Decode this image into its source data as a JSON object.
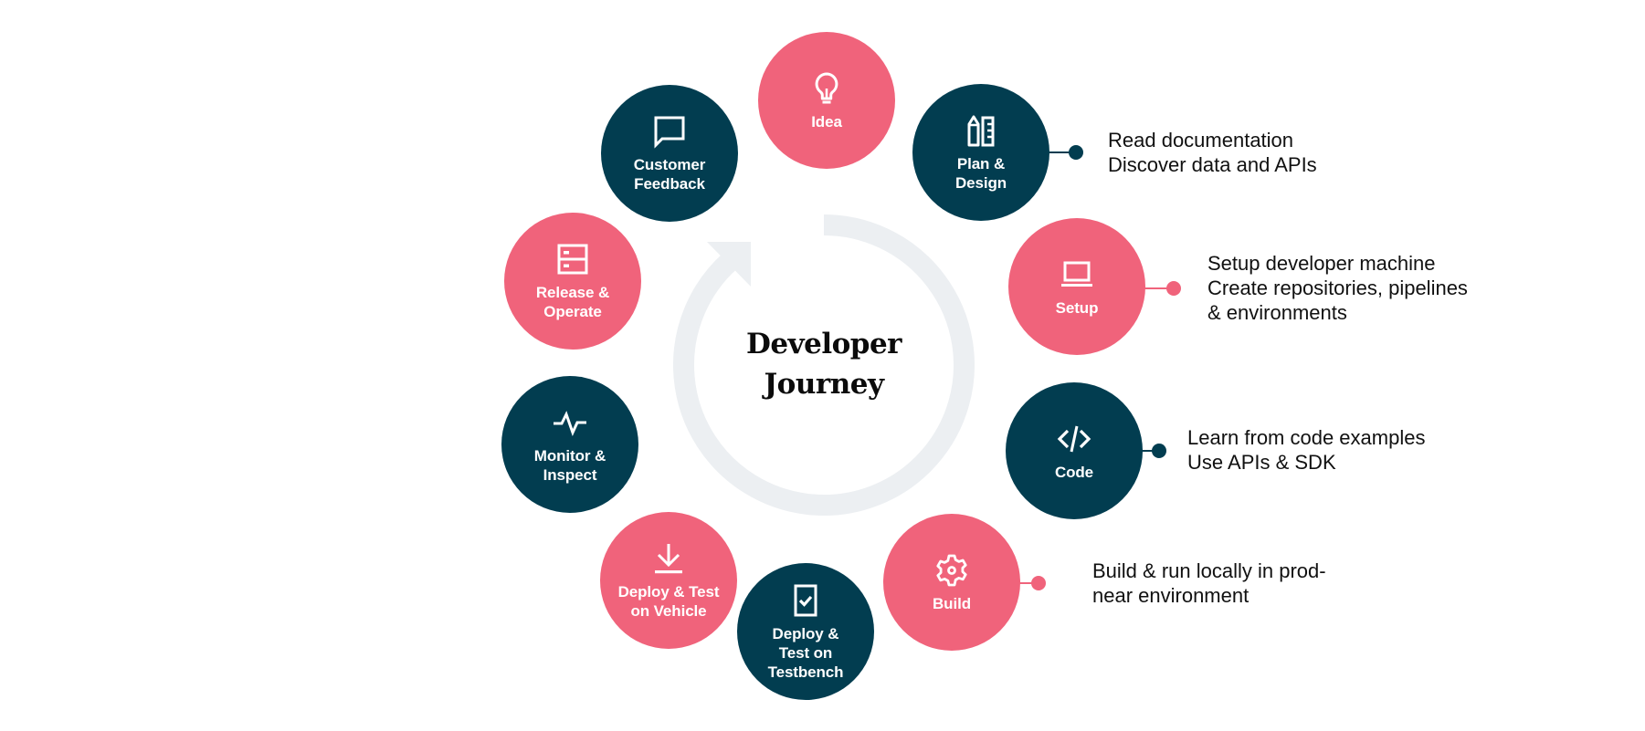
{
  "diagram": {
    "title_lines": [
      "Developer",
      "Journey"
    ],
    "colors": {
      "pink": "#F0637B",
      "navy": "#023D50",
      "ring": "#ECEFF2",
      "text": "#111111"
    },
    "steps": [
      {
        "id": "idea",
        "label": "Idea",
        "icon": "lightbulb-icon",
        "color": "pink"
      },
      {
        "id": "plan-design",
        "label": "Plan &\nDesign",
        "icon": "pencil-ruler-icon",
        "color": "navy",
        "notes": [
          "Read documentation",
          "Discover data and APIs"
        ]
      },
      {
        "id": "setup",
        "label": "Setup",
        "icon": "laptop-icon",
        "color": "pink",
        "notes": [
          "Setup developer machine",
          "Create repositories, pipelines",
          "& environments"
        ]
      },
      {
        "id": "code",
        "label": "Code",
        "icon": "code-icon",
        "color": "navy",
        "notes": [
          "Learn from code examples",
          "Use APIs & SDK"
        ]
      },
      {
        "id": "build",
        "label": "Build",
        "icon": "gear-icon",
        "color": "pink",
        "notes": [
          "Build & run locally in prod-",
          "near environment"
        ]
      },
      {
        "id": "deploy-testbench",
        "label": "Deploy &\nTest on\nTestbench",
        "icon": "checklist-icon",
        "color": "navy"
      },
      {
        "id": "deploy-vehicle",
        "label": "Deploy & Test\non Vehicle",
        "icon": "download-icon",
        "color": "pink"
      },
      {
        "id": "monitor-inspect",
        "label": "Monitor &\nInspect",
        "icon": "pulse-icon",
        "color": "navy"
      },
      {
        "id": "release-operate",
        "label": "Release &\nOperate",
        "icon": "server-icon",
        "color": "pink"
      },
      {
        "id": "customer-feedback",
        "label": "Customer\nFeedback",
        "icon": "chat-bubble-icon",
        "color": "navy"
      }
    ]
  }
}
